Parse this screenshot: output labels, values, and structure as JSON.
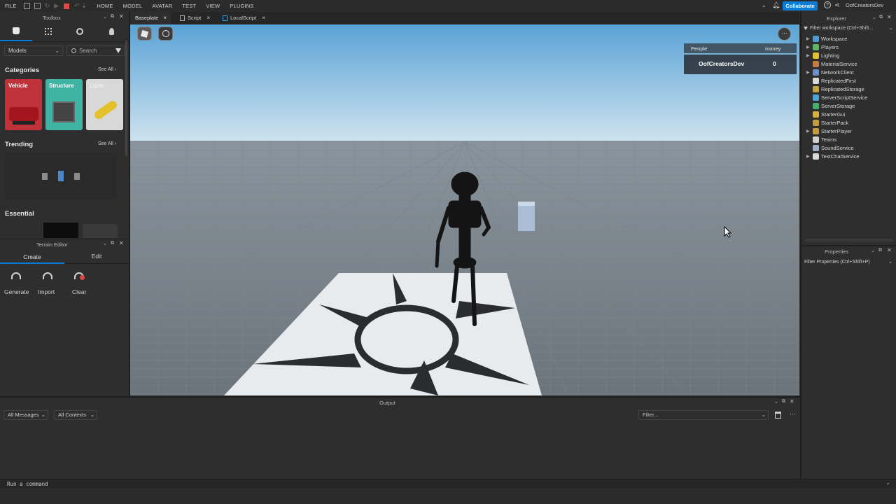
{
  "menubar": {
    "file": "FILE",
    "items": [
      "HOME",
      "MODEL",
      "AVATAR",
      "TEST",
      "VIEW",
      "PLUGINS"
    ],
    "collaborate": "Collaborate",
    "username": "OofCreatorsDev"
  },
  "tabs": [
    {
      "label": "Baseplate",
      "active": true
    },
    {
      "label": "Script",
      "active": false
    },
    {
      "label": "LocalScript",
      "active": false
    }
  ],
  "toolbox": {
    "title": "Toolbox",
    "category_dropdown": "Models",
    "search_placeholder": "Search",
    "categories_heading": "Categories",
    "see_all": "See All",
    "category_cards": [
      {
        "label": "Vehicle",
        "color": "#c0323a"
      },
      {
        "label": "Structure",
        "color": "#3fb3a4"
      },
      {
        "label": "Light",
        "color": "#d8d8d8"
      }
    ],
    "trending_heading": "Trending",
    "essential_heading": "Essential"
  },
  "terrain": {
    "title": "Terrain Editor",
    "tab_create": "Create",
    "tab_edit": "Edit",
    "tools": [
      "Generate",
      "Import",
      "Clear"
    ]
  },
  "leaderboard": {
    "col_people": "People",
    "col_money": "money",
    "player": "OofCreatorsDev",
    "money": "0"
  },
  "explorer": {
    "title": "Explorer",
    "filter": "Filter workspace (Ctrl+Shift...",
    "items": [
      {
        "label": "Workspace",
        "expandable": true,
        "color": "#4a9bd9"
      },
      {
        "label": "Players",
        "expandable": true,
        "color": "#5bb85b"
      },
      {
        "label": "Lighting",
        "expandable": true,
        "color": "#e3c12a"
      },
      {
        "label": "MaterialService",
        "expandable": false,
        "color": "#c87b3a"
      },
      {
        "label": "NetworkClient",
        "expandable": true,
        "color": "#6a8fd0"
      },
      {
        "label": "ReplicatedFirst",
        "expandable": false,
        "color": "#d9d9d9"
      },
      {
        "label": "ReplicatedStorage",
        "expandable": false,
        "color": "#c9a23a"
      },
      {
        "label": "ServerScriptService",
        "expandable": false,
        "color": "#4aa3d9"
      },
      {
        "label": "ServerStorage",
        "expandable": false,
        "color": "#3fb36a"
      },
      {
        "label": "StarterGui",
        "expandable": false,
        "color": "#d9b13a"
      },
      {
        "label": "StarterPack",
        "expandable": false,
        "color": "#c99a3a"
      },
      {
        "label": "StarterPlayer",
        "expandable": true,
        "color": "#c99a3a"
      },
      {
        "label": "Teams",
        "expandable": false,
        "color": "#d0d0d0"
      },
      {
        "label": "SoundService",
        "expandable": false,
        "color": "#9ab0c9"
      },
      {
        "label": "TextChatService",
        "expandable": true,
        "color": "#d9d9d9"
      }
    ]
  },
  "properties": {
    "title": "Properties",
    "filter": "Filter Properties (Ctrl+Shift+P)"
  },
  "output": {
    "title": "Output",
    "messages_dropdown": "All Messages",
    "contexts_dropdown": "All Contexts",
    "filter_placeholder": "Filter...",
    "command_placeholder": "Run a command"
  }
}
